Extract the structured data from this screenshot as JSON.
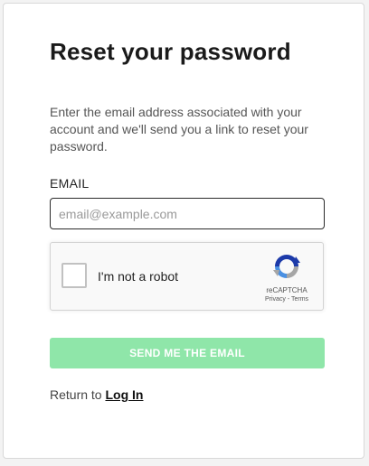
{
  "title": "Reset your password",
  "description": "Enter the email address associated with your account and we'll send you a link to reset your password.",
  "email": {
    "label": "EMAIL",
    "placeholder": "email@example.com",
    "value": ""
  },
  "captcha": {
    "label": "I'm not a robot",
    "brand": "reCAPTCHA",
    "privacy": "Privacy",
    "separator": " - ",
    "terms": "Terms",
    "icon": "recaptcha-logo-icon",
    "checked": false
  },
  "submit": {
    "label": "SEND ME THE EMAIL",
    "color": "#8fe6a9"
  },
  "footer": {
    "prefix": "Return to ",
    "login_label": "Log In"
  }
}
